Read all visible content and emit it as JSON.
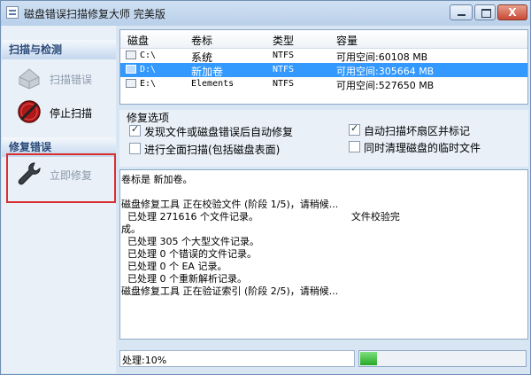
{
  "window": {
    "title": "磁盘错误扫描修复大师 完美版",
    "close_glyph": "X"
  },
  "sidebar": {
    "scan_section": "扫描与检测",
    "scan_error": "扫描错误",
    "stop_scan": "停止扫描",
    "repair_section": "修复错误",
    "repair_now": "立即修复"
  },
  "drive_list": {
    "columns": [
      "磁盘",
      "卷标",
      "类型",
      "容量"
    ],
    "rows": [
      {
        "drive": "C:\\",
        "label": "系统",
        "type": "NTFS",
        "capacity": "可用空间:60108 MB",
        "selected": false
      },
      {
        "drive": "D:\\",
        "label": "新加卷",
        "type": "NTFS",
        "capacity": "可用空间:305664 MB",
        "selected": true
      },
      {
        "drive": "E:\\",
        "label": "Elements",
        "type": "NTFS",
        "capacity": "可用空间:527650 MB",
        "selected": false
      }
    ]
  },
  "options": {
    "title": "修复选项",
    "items": [
      {
        "label": "发现文件或磁盘错误后自动修复",
        "checked": true
      },
      {
        "label": "自动扫描坏扇区并标记",
        "checked": true
      },
      {
        "label": "进行全面扫描(包括磁盘表面)",
        "checked": false
      },
      {
        "label": "同时清理磁盘的临时文件",
        "checked": false
      }
    ]
  },
  "log": {
    "lines": [
      "卷标是 新加卷。",
      "",
      "磁盘修复工具 正在校验文件 (阶段 1/5)，请稍候...",
      "  已处理 271616 个文件记录。                              文件校验完",
      "成。",
      "  已处理 305 个大型文件记录。",
      "  已处理 0 个错误的文件记录。",
      "  已处理 0 个 EA 记录。",
      "  已处理 0 个重新解析记录。",
      "磁盘修复工具 正在验证索引 (阶段 2/5)，请稍候..."
    ]
  },
  "status": {
    "text": "处理:10%",
    "progress": 0.1
  },
  "colors": {
    "selection": "#3399ff",
    "progress": "#26a826",
    "highlight_border": "#d83030"
  }
}
